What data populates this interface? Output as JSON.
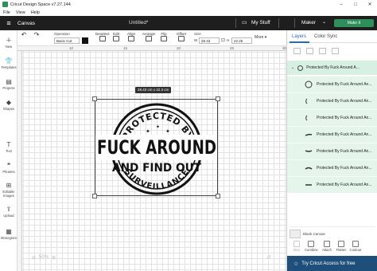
{
  "window": {
    "title": "Cricut Design Space  v7.27.144",
    "controls": [
      "minimize-icon",
      "maximize-icon",
      "close-icon"
    ]
  },
  "menubar": {
    "items": [
      "File",
      "View",
      "Help"
    ]
  },
  "header": {
    "page_name": "Canvas",
    "document_title": "Untitled*",
    "my_stuff": "My Stuff",
    "my_stuff_icon": "folder-icon",
    "machine": "Maker",
    "make_button": "Make It"
  },
  "toolbar": {
    "undo": "Undo",
    "redo": "Redo",
    "operation_label": "Operation",
    "operation_value": "Basic Cut",
    "deselect": "Deselect",
    "edit": "Edit",
    "align": "Align",
    "arrange": "Arrange",
    "flip": "Flip",
    "offset": "Offset",
    "size_label": "Size",
    "width": "28.43",
    "height": "22.25",
    "more": "More",
    "swatch_color": "#111111"
  },
  "leftbar": {
    "items": [
      {
        "icon": "plus-icon",
        "label": "New"
      },
      {
        "icon": "templates-icon",
        "label": "Templates"
      },
      {
        "icon": "projects-icon",
        "label": "Projects"
      },
      {
        "icon": "shapes-icon",
        "label": "Shapes"
      },
      {
        "icon": "text-icon",
        "label": "Text"
      },
      {
        "icon": "phrases-icon",
        "label": "Phrases"
      },
      {
        "icon": "editable-images-icon",
        "label": "Editable Images"
      },
      {
        "icon": "upload-icon",
        "label": "Upload"
      },
      {
        "icon": "monogram-icon",
        "label": "Monogram"
      }
    ]
  },
  "canvas": {
    "ruler_marks": [
      "10",
      "15",
      "20",
      "25",
      "30"
    ],
    "dimension_label": "28.43  cm x 22.3  cm",
    "design": {
      "top_arc_text": "PROTECTED BY",
      "middle_text": "FUCK AROUND",
      "middle2_text": "AND FIND OUT",
      "bottom_arc_text": "SURVEILLANCE"
    },
    "zoom": "50%"
  },
  "panel": {
    "tabs": [
      "Layers",
      "Color Sync"
    ],
    "active_tab": "Layers",
    "group_name": "Protected By Fuck Around A...",
    "layers": [
      {
        "name": "Protected By Fuck Around An..."
      },
      {
        "name": "Protected By Fuck Around An..."
      },
      {
        "name": "Protected By Fuck Around An..."
      },
      {
        "name": "Protected By Fuck Around An..."
      },
      {
        "name": "Protected By Fuck Around An..."
      },
      {
        "name": "Protected By Fuck Around An..."
      },
      {
        "name": "Protected By Fuck Around An..."
      }
    ],
    "blank_canvas": "Blank Canvas",
    "bottom_tools": [
      "Slice",
      "Combine",
      "Attach",
      "Flatten",
      "Contour"
    ],
    "access_banner": "Try Cricut Access for free"
  }
}
